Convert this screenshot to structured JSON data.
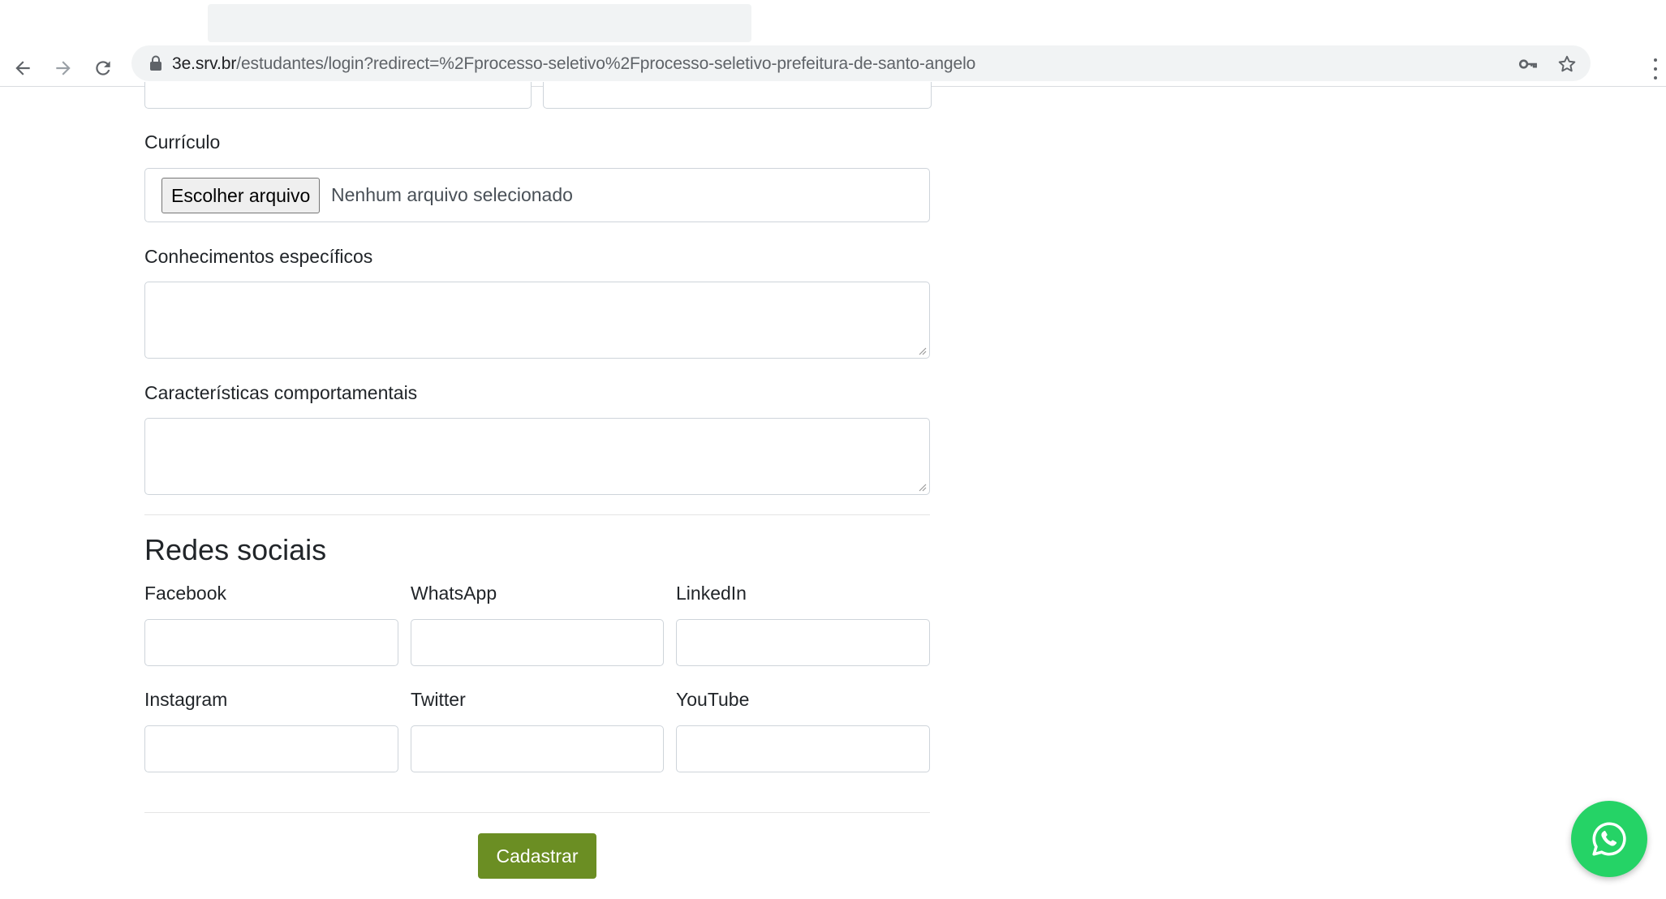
{
  "browser": {
    "url_host": "3e.srv.br",
    "url_path": "/estudantes/login?redirect=%2Fprocesso-seletivo%2Fprocesso-seletivo-prefeitura-de-santo-angelo",
    "icons": [
      "back-arrow-icon",
      "forward-arrow-icon",
      "reload-icon",
      "lock-icon",
      "key-icon",
      "star-icon",
      "menu-icon"
    ]
  },
  "form": {
    "curriculo": {
      "label": "Currículo",
      "button_label": "Escolher arquivo",
      "status": "Nenhum arquivo selecionado"
    },
    "conhecimentos": {
      "label": "Conhecimentos específicos",
      "value": ""
    },
    "caracteristicas": {
      "label": "Características comportamentais",
      "value": ""
    },
    "social": {
      "title": "Redes sociais",
      "fields": [
        {
          "label": "Facebook",
          "value": ""
        },
        {
          "label": "WhatsApp",
          "value": ""
        },
        {
          "label": "LinkedIn",
          "value": ""
        },
        {
          "label": "Instagram",
          "value": ""
        },
        {
          "label": "Twitter",
          "value": ""
        },
        {
          "label": "YouTube",
          "value": ""
        }
      ]
    },
    "submit_label": "Cadastrar"
  },
  "colors": {
    "submit": "#6b8e23",
    "whatsapp": "#25d366",
    "border": "#ced4da"
  },
  "floating": {
    "icon": "whatsapp-icon"
  }
}
